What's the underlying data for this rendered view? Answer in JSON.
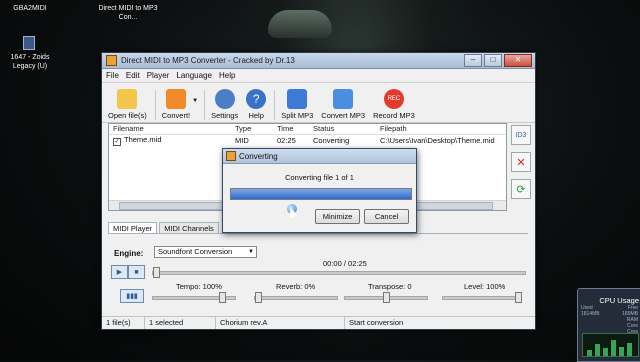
{
  "desktop": {
    "icons": [
      {
        "label": "GBA2MIDI"
      },
      {
        "label": "Direct MIDI to MP3 Con..."
      },
      {
        "label": "1647 - Zoids Legacy (U)"
      }
    ]
  },
  "window": {
    "title": "Direct MIDI to MP3 Converter - Cracked by Dr.13",
    "menu": [
      "File",
      "Edit",
      "Player",
      "Language",
      "Help"
    ],
    "toolbar": [
      {
        "label": "Open file(s)",
        "icon": "open-folder-icon",
        "color": "#f2c64a"
      },
      {
        "label": "Convert!",
        "icon": "convert-icon",
        "color": "#f08a2a"
      },
      {
        "label": "Settings",
        "icon": "gear-icon",
        "color": "#4b7fc4"
      },
      {
        "label": "Help",
        "icon": "help-icon",
        "color": "#3a72c9"
      },
      {
        "label": "Split MP3",
        "icon": "split-mp3-icon",
        "color": "#3b7bd6"
      },
      {
        "label": "Convert MP3",
        "icon": "convert-mp3-icon",
        "color": "#4a8ee0"
      },
      {
        "label": "Record MP3",
        "icon": "record-icon",
        "color": "#e23b2b"
      }
    ],
    "filelist": {
      "headers": [
        "Filename",
        "Type",
        "Time",
        "Status",
        "Filepath"
      ],
      "rows": [
        {
          "filename": "Theme.mid",
          "type": "MID",
          "time": "02:25",
          "status": "Converting",
          "filepath": "C:\\Users\\Ivan\\Desktop\\Theme.mid"
        }
      ]
    },
    "tabs": [
      "MIDI Player",
      "MIDI Channels"
    ],
    "player": {
      "engine_label": "Engine:",
      "engine_value": "Soundfont Conversion",
      "timecode": "00:00 / 02:25",
      "tempo": "Tempo: 100%",
      "reverb": "Reverb: 0%",
      "transpose": "Transpose: 0",
      "level": "Level: 100%"
    },
    "statusbar": [
      "1 file(s)",
      "1 selected",
      "Chorium rev.A",
      "Start conversion"
    ]
  },
  "dialog": {
    "title": "Converting",
    "message": "Converting file 1 of 1",
    "progress": 1.0,
    "minimize_label": "Minimize",
    "cancel_label": "Cancel"
  },
  "cpu_gadget": {
    "title": "CPU Usage",
    "used_label": "Used",
    "used_value": "1814MB",
    "free_label": "Free",
    "free_value": "189MB",
    "ram_label": "RAM",
    "core1_label": "Core",
    "core2_label": "Core"
  }
}
